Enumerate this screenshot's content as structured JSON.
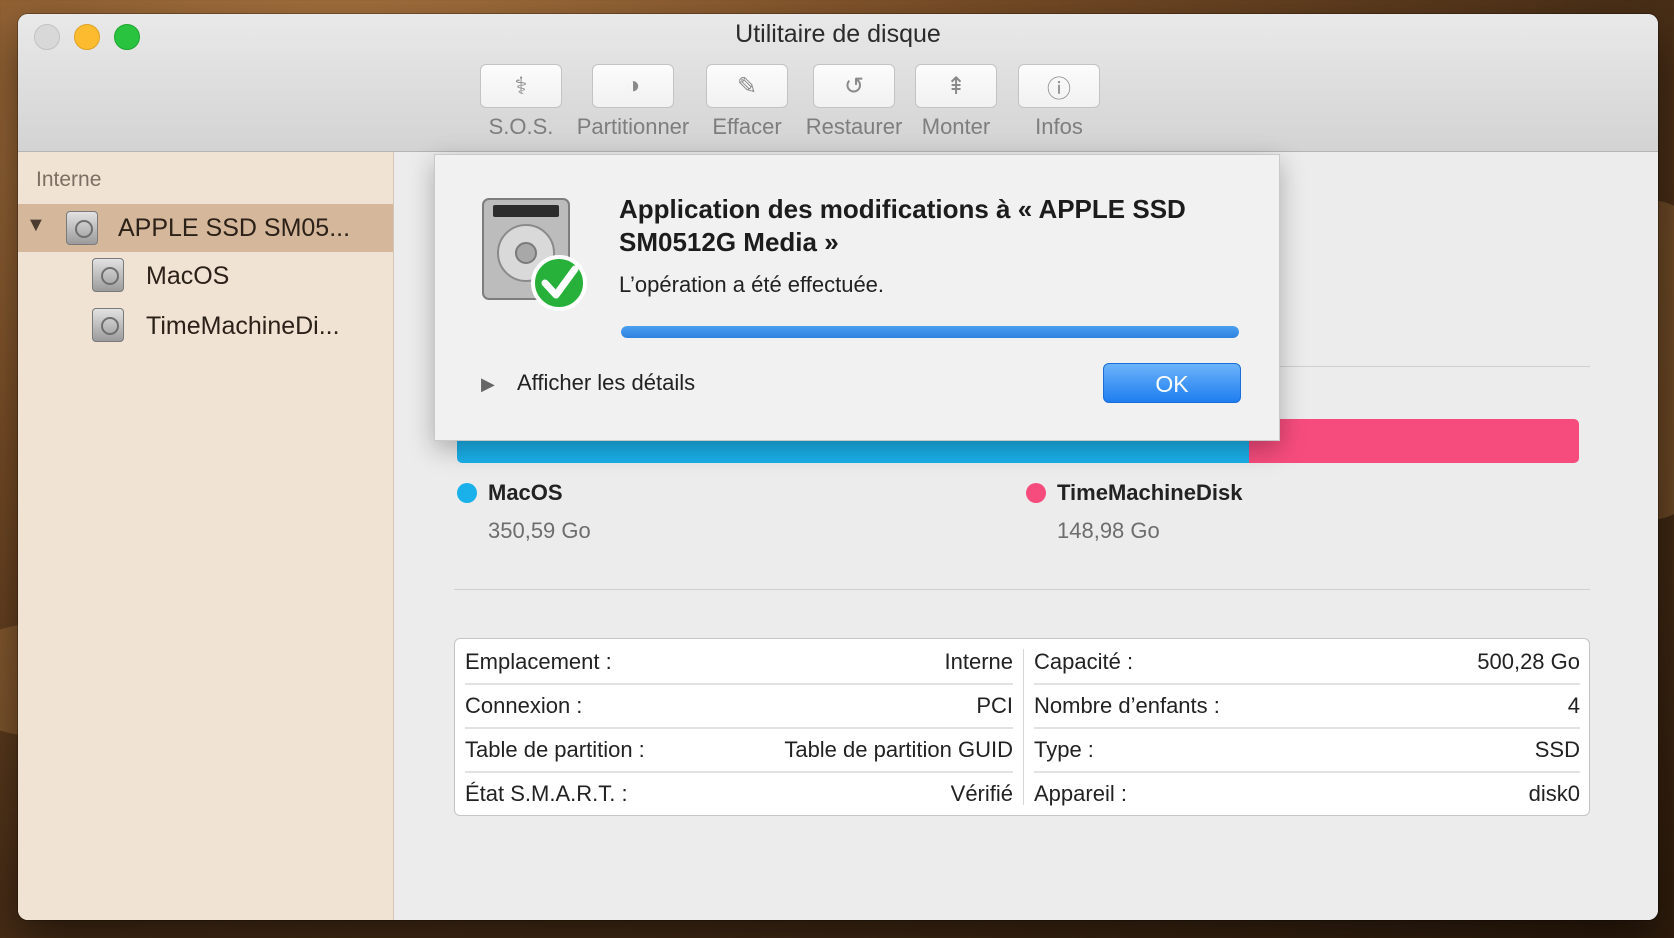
{
  "window": {
    "title": "Utilitaire de disque"
  },
  "toolbar": {
    "items": [
      {
        "label": "S.O.S.",
        "icon": "stethoscope-icon"
      },
      {
        "label": "Partitionner",
        "icon": "pie-chart-icon"
      },
      {
        "label": "Effacer",
        "icon": "erase-icon"
      },
      {
        "label": "Restaurer",
        "icon": "restore-icon"
      },
      {
        "label": "Monter",
        "icon": "mount-icon"
      },
      {
        "label": "Infos",
        "icon": "info-icon"
      }
    ]
  },
  "sidebar": {
    "heading": "Interne",
    "disk": "APPLE SSD SM05...",
    "volumes": [
      "MacOS",
      "TimeMachineDi..."
    ]
  },
  "usage": {
    "segments": [
      {
        "name": "MacOS",
        "size": "350,59 Go",
        "fraction": 0.7056,
        "color": "#1ab0ea"
      },
      {
        "name": "TimeMachineDisk",
        "size": "148,98 Go",
        "fraction": 0.2944,
        "color": "#f64c7d"
      }
    ]
  },
  "info": {
    "left": [
      {
        "key": "Emplacement :",
        "value": "Interne"
      },
      {
        "key": "Connexion :",
        "value": "PCI"
      },
      {
        "key": "Table de partition :",
        "value": "Table de partition GUID"
      },
      {
        "key": "État S.M.A.R.T. :",
        "value": "Vérifié"
      }
    ],
    "right": [
      {
        "key": "Capacité :",
        "value": "500,28 Go"
      },
      {
        "key": "Nombre d’enfants :",
        "value": "4"
      },
      {
        "key": "Type :",
        "value": "SSD"
      },
      {
        "key": "Appareil :",
        "value": "disk0"
      }
    ]
  },
  "sheet": {
    "title": "Application des modifications à « APPLE SSD SM0512G Media »",
    "message": "L’opération a été effectuée.",
    "progress": 1.0,
    "details_label": "Afficher les détails",
    "ok_label": "OK"
  }
}
